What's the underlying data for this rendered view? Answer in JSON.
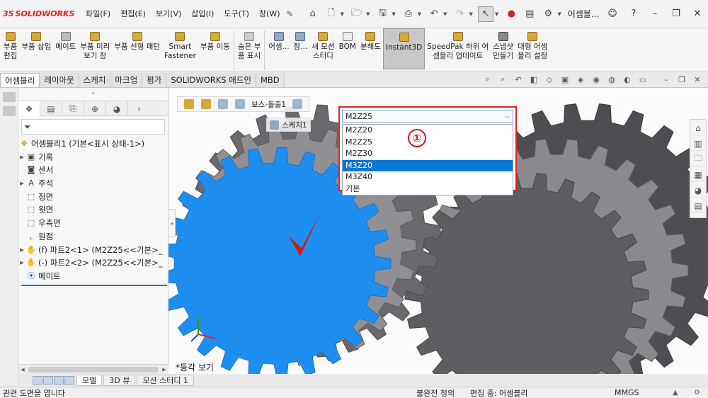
{
  "app": {
    "logo": "SOLIDWORKS",
    "document_title": "어셈블..."
  },
  "menus": [
    "파일(F)",
    "편집(E)",
    "보기(V)",
    "삽입(I)",
    "도구(T)",
    "창(W)"
  ],
  "ribbon": [
    {
      "label": "부품\n편집",
      "name": "ribbon-edit-part"
    },
    {
      "label": "부품 삽입",
      "name": "ribbon-insert-part"
    },
    {
      "label": "메이트",
      "name": "ribbon-mate"
    },
    {
      "label": "부품 미리\n보기 창",
      "name": "ribbon-preview-window"
    },
    {
      "label": "부품 선형 패턴",
      "name": "ribbon-linear-pattern"
    },
    {
      "label": "Smart\nFastener",
      "name": "ribbon-smart-fastener"
    },
    {
      "label": "부품 이동",
      "name": "ribbon-move-component"
    },
    {
      "label": "숨은 부\n품 표시",
      "name": "ribbon-show-hidden"
    },
    {
      "label": "어셈...",
      "name": "ribbon-assembly-features"
    },
    {
      "label": "참...",
      "name": "ribbon-reference"
    },
    {
      "label": "새 모션\n스터디",
      "name": "ribbon-new-motion-study"
    },
    {
      "label": "BOM",
      "name": "ribbon-bom"
    },
    {
      "label": "분해도",
      "name": "ribbon-exploded-view"
    },
    {
      "label": "Instant3D",
      "name": "ribbon-instant3d"
    },
    {
      "label": "SpeedPak 하위 어\n셈블리 업데이트",
      "name": "ribbon-speedpak"
    },
    {
      "label": "스냅샷\n만들기",
      "name": "ribbon-snapshot"
    },
    {
      "label": "대형 어셈\n블리 설정",
      "name": "ribbon-large-assembly"
    }
  ],
  "tabs": [
    "어셈블리",
    "레이아웃",
    "스케치",
    "마크업",
    "평가",
    "SOLIDWORKS 애드인",
    "MBD"
  ],
  "tree": {
    "root": "어셈블리1  (기본<표시 상태-1>)",
    "items": [
      {
        "label": "기록",
        "icon": "folder-icon",
        "exp": true
      },
      {
        "label": "센서",
        "icon": "sensor-icon",
        "exp": false
      },
      {
        "label": "주석",
        "icon": "annotation-icon",
        "exp": true
      },
      {
        "label": "정면",
        "icon": "plane-icon",
        "exp": false
      },
      {
        "label": "윗면",
        "icon": "plane-icon",
        "exp": false
      },
      {
        "label": "우측면",
        "icon": "plane-icon",
        "exp": false
      },
      {
        "label": "원점",
        "icon": "origin-icon",
        "exp": false
      },
      {
        "label": "(f) 파트2<1> (M2Z25<<기본>_",
        "icon": "part-icon",
        "exp": true,
        "highlight": true
      },
      {
        "label": "(-) 파트2<2> (M2Z25<<기본>_",
        "icon": "part-icon",
        "exp": true
      },
      {
        "label": "메이트",
        "icon": "mates-icon",
        "exp": false
      }
    ]
  },
  "breadcrumb": {
    "feature": "보스-돌출1",
    "sketch": "스케치1"
  },
  "config_dropdown": {
    "selected": "M2Z25",
    "options": [
      "M2Z20",
      "M2Z25",
      "M2Z30",
      "M3Z20",
      "M3Z40",
      "기본"
    ],
    "highlighted_index": 3,
    "callout": "①"
  },
  "graphics": {
    "view_label": "*등각 보기"
  },
  "bottom_tabs": [
    "모델",
    "3D 뷰",
    "모션 스터디 1"
  ],
  "status": {
    "message": "관련 도면을 엽니다",
    "definition": "불완전 정의",
    "editing": "편집 중: 어셈블리",
    "units": "MMGS"
  },
  "colors": {
    "selected_gear": "#1e8ff0",
    "gear_gray": "#6b6b6f",
    "highlight_red": "#e02424",
    "list_selection": "#0a78d7"
  }
}
